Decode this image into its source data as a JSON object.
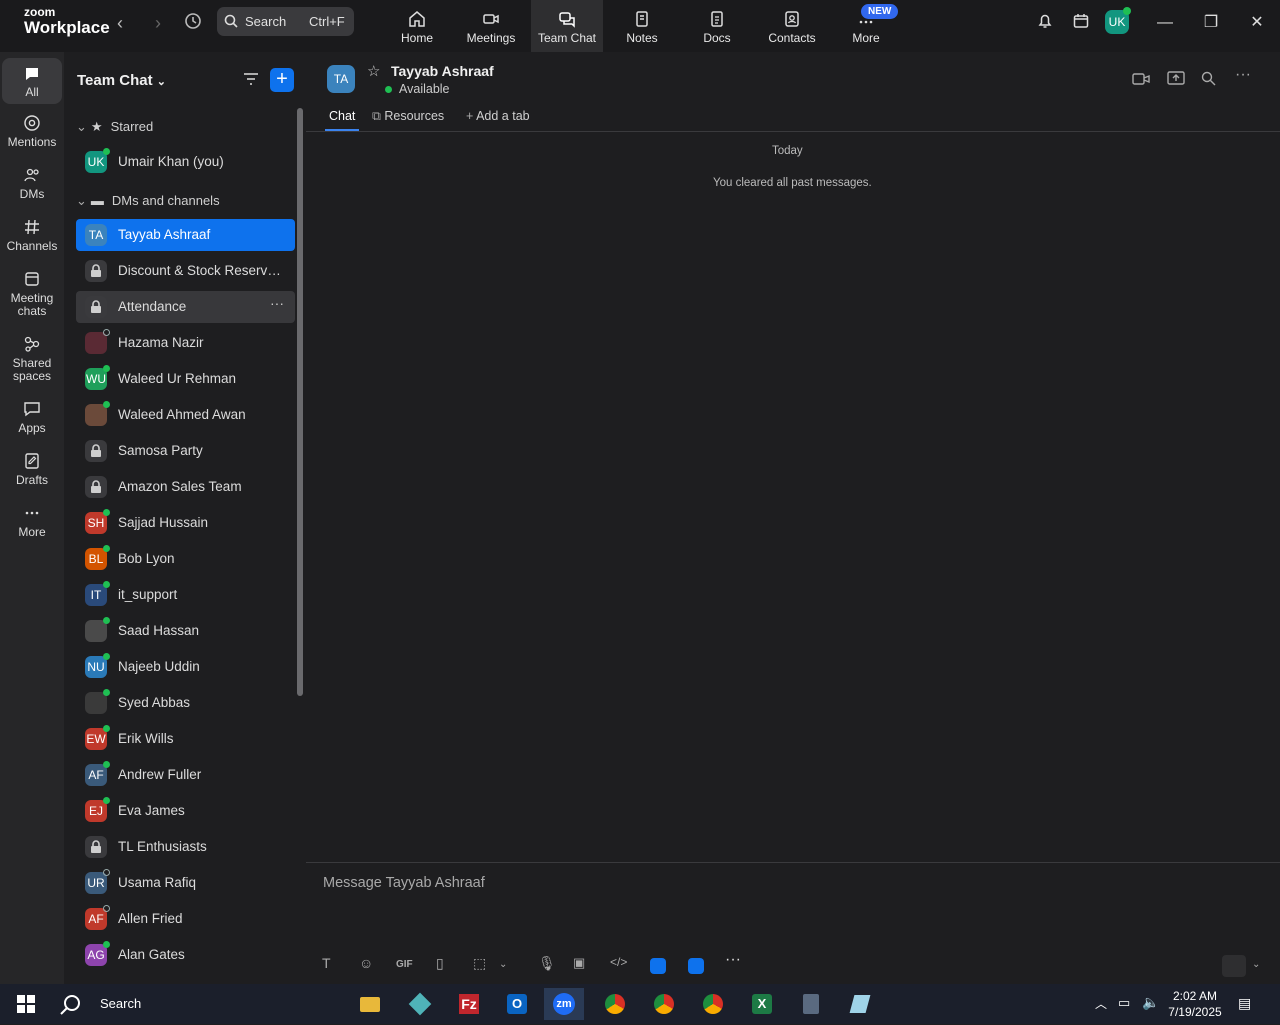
{
  "app": {
    "logo_top": "zoom",
    "logo_bottom": "Workplace"
  },
  "search": {
    "label": "Search",
    "shortcut": "Ctrl+F"
  },
  "topnav": [
    {
      "label": "Home",
      "icon": "home-icon"
    },
    {
      "label": "Meetings",
      "icon": "video-icon"
    },
    {
      "label": "Team Chat",
      "icon": "chat-icon"
    },
    {
      "label": "Notes",
      "icon": "notes-icon"
    },
    {
      "label": "Docs",
      "icon": "docs-icon"
    },
    {
      "label": "Contacts",
      "icon": "contacts-icon"
    },
    {
      "label": "More",
      "icon": "more-icon"
    }
  ],
  "new_badge": "NEW",
  "user_initials": "UK",
  "rail": [
    {
      "label": "All"
    },
    {
      "label": "Mentions"
    },
    {
      "label": "DMs"
    },
    {
      "label": "Channels"
    },
    {
      "label": "Meeting chats"
    },
    {
      "label": "Shared spaces"
    },
    {
      "label": "Apps"
    },
    {
      "label": "Drafts"
    },
    {
      "label": "More"
    }
  ],
  "sidebar": {
    "title": "Team Chat",
    "starred_label": "Starred",
    "dms_label": "DMs and channels",
    "starred": [
      {
        "initials": "UK",
        "name": "Umair Khan (you)",
        "color": "#12967f"
      }
    ],
    "items": [
      {
        "initials": "TA",
        "name": "Tayyab Ashraaf",
        "color": "#3b83bd"
      },
      {
        "initials": "",
        "name": "Discount & Stock Reservati...",
        "color": "#3a3a3d"
      },
      {
        "initials": "",
        "name": "Attendance",
        "color": "#3a3a3d"
      },
      {
        "initials": "",
        "name": "Hazama Nazir",
        "color": "#5a2a34"
      },
      {
        "initials": "WU",
        "name": "Waleed Ur Rehman",
        "color": "#1f9f5a"
      },
      {
        "initials": "",
        "name": "Waleed Ahmed Awan",
        "color": "#6b4a3a"
      },
      {
        "initials": "",
        "name": "Samosa Party",
        "color": "#3a3a3d"
      },
      {
        "initials": "",
        "name": "Amazon Sales Team",
        "color": "#3a3a3d"
      },
      {
        "initials": "SH",
        "name": "Sajjad Hussain",
        "color": "#c0392b"
      },
      {
        "initials": "BL",
        "name": "Bob Lyon",
        "color": "#d35400"
      },
      {
        "initials": "IT",
        "name": "it_support",
        "color": "#2a4a7a"
      },
      {
        "initials": "",
        "name": "Saad Hassan",
        "color": "#4a4a4a"
      },
      {
        "initials": "NU",
        "name": "Najeeb Uddin",
        "color": "#2a7ab8"
      },
      {
        "initials": "",
        "name": "Syed Abbas",
        "color": "#3a3a3a"
      },
      {
        "initials": "EW",
        "name": "Erik Wills",
        "color": "#c0392b"
      },
      {
        "initials": "AF",
        "name": "Andrew Fuller",
        "color": "#3a5a7a"
      },
      {
        "initials": "EJ",
        "name": "Eva James",
        "color": "#c0392b"
      },
      {
        "initials": "",
        "name": "TL Enthusiasts",
        "color": "#3a3a3d"
      },
      {
        "initials": "UR",
        "name": "Usama Rafiq",
        "color": "#3a5a7a"
      },
      {
        "initials": "AF",
        "name": "Allen Fried",
        "color": "#c0392b"
      },
      {
        "initials": "AG",
        "name": "Alan Gates",
        "color": "#8e44ad"
      }
    ]
  },
  "chat": {
    "initials": "TA",
    "name": "Tayyab Ashraaf",
    "status": "Available",
    "tabs": [
      "Chat",
      "Resources",
      "Add a tab"
    ],
    "date_divider": "Today",
    "system_message": "You cleared all past messages.",
    "compose_placeholder": "Message Tayyab Ashraaf"
  },
  "taskbar": {
    "search_label": "Search",
    "time": "2:02 AM",
    "date": "7/19/2025"
  }
}
